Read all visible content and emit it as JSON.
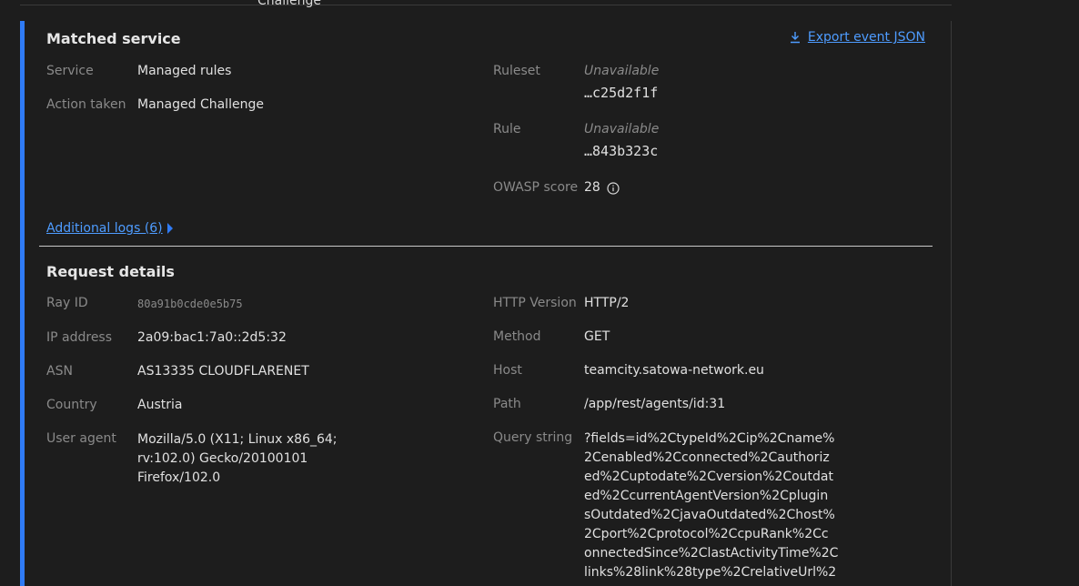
{
  "top_remnant": {
    "text": "Challenge"
  },
  "matched_service": {
    "title": "Matched service",
    "export_label": "Export event JSON",
    "fields_left": [
      {
        "label": "Service",
        "value": "Managed rules"
      },
      {
        "label": "Action taken",
        "value": "Managed Challenge"
      }
    ],
    "ruleset": {
      "label": "Ruleset",
      "status": "Unavailable",
      "id": "…c25d2f1f"
    },
    "rule": {
      "label": "Rule",
      "status": "Unavailable",
      "id": "…843b323c"
    },
    "owasp": {
      "label": "OWASP score",
      "value": "28"
    },
    "additional_logs": "Additional logs (6)"
  },
  "request_details": {
    "title": "Request details",
    "left": [
      {
        "label": "Ray ID",
        "value": "80a91b0cde0e5b75"
      },
      {
        "label": "IP address",
        "value": "2a09:bac1:7a0::2d5:32"
      },
      {
        "label": "ASN",
        "value": "AS13335 CLOUDFLARENET"
      },
      {
        "label": "Country",
        "value": "Austria"
      },
      {
        "label": "User agent",
        "lines": [
          "Mozilla/5.0 (X11; Linux x86_64;",
          "rv:102.0) Gecko/20100101",
          "Firefox/102.0"
        ]
      }
    ],
    "right": [
      {
        "label": "HTTP Version",
        "value": "HTTP/2"
      },
      {
        "label": "Method",
        "value": "GET"
      },
      {
        "label": "Host",
        "value": "teamcity.satowa-network.eu"
      },
      {
        "label": "Path",
        "value": "/app/rest/agents/id:31"
      },
      {
        "label": "Query string",
        "lines": [
          "?fields=id%2CtypeId%2Cip%2Cname%",
          "2Cenabled%2Cconnected%2Cauthoriz",
          "ed%2Cuptodate%2Cversion%2Coutdat",
          "ed%2CcurrentAgentVersion%2Cplugin",
          "sOutdated%2CjavaOutdated%2Chost%",
          "2Cport%2Cprotocol%2CcpuRank%2Cc",
          "onnectedSince%2ClastActivityTime%2C",
          "links%28link%28type%2CrelativeUrl%2"
        ]
      }
    ]
  },
  "colors": {
    "accent": "#2f7bf6",
    "link": "#4e9cff",
    "background": "#1d1d1d"
  }
}
